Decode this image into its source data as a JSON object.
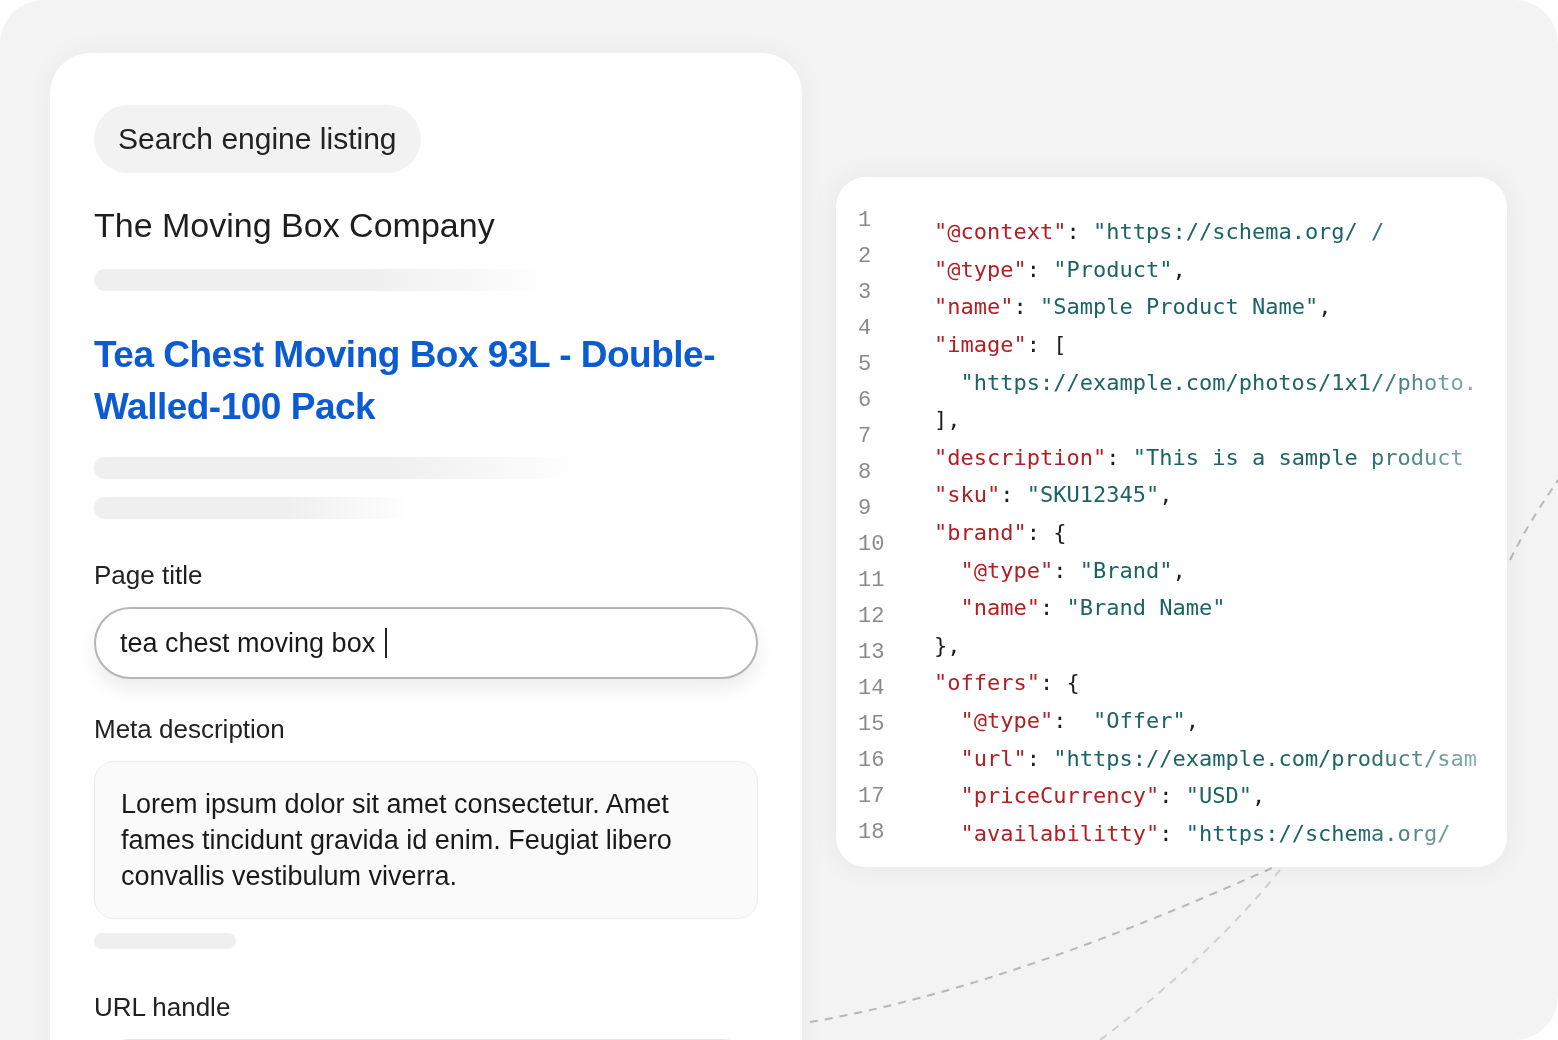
{
  "listing": {
    "badge": "Search engine listing",
    "site_name": "The Moving Box Company",
    "result_title": "Tea Chest Moving Box 93L - Double-Walled-100 Pack"
  },
  "fields": [
    {
      "label": "Page title",
      "kind": "input",
      "value": "tea chest moving box ",
      "focused": true
    },
    {
      "label": "Meta description",
      "kind": "textarea",
      "value": "Lorem ipsum dolor sit amet consectetur. Amet fames tincidunt gravida id enim. Feugiat libero convallis vestibulum viverra."
    },
    {
      "label": "URL handle",
      "kind": "input"
    }
  ],
  "line_numbers": [
    "1",
    "2",
    "3",
    "4",
    "5",
    "6",
    "7",
    "8",
    "9",
    "10",
    "11",
    "12",
    "13",
    "14",
    "15",
    "16",
    "17",
    "18"
  ],
  "code_lines": [
    {
      "tokens": [
        {
          "kind": "key",
          "text": "\"@context\""
        },
        {
          "kind": "punct",
          "text": ": "
        },
        {
          "kind": "string",
          "text": "\"https://schema.org/ /"
        }
      ]
    },
    {
      "tokens": [
        {
          "kind": "key",
          "text": "\"@type\""
        },
        {
          "kind": "punct",
          "text": ": "
        },
        {
          "kind": "string",
          "text": "\"Product\""
        },
        {
          "kind": "punct",
          "text": ","
        }
      ]
    },
    {
      "tokens": [
        {
          "kind": "key",
          "text": "\"name\""
        },
        {
          "kind": "punct",
          "text": ": "
        },
        {
          "kind": "string",
          "text": "\"Sample Product Name\""
        },
        {
          "kind": "punct",
          "text": ","
        }
      ]
    },
    {
      "tokens": [
        {
          "kind": "key",
          "text": "\"image\""
        },
        {
          "kind": "punct",
          "text": ": ["
        }
      ]
    },
    {
      "tokens": [
        {
          "kind": "string",
          "text": "  \"https://example.com/photos/1x1//photo."
        }
      ]
    },
    {
      "tokens": [
        {
          "kind": "punct",
          "text": "],"
        }
      ]
    },
    {
      "tokens": [
        {
          "kind": "key",
          "text": "\"description\""
        },
        {
          "kind": "punct",
          "text": ": "
        },
        {
          "kind": "string",
          "text": "\"This is a sample product"
        }
      ]
    },
    {
      "tokens": [
        {
          "kind": "key",
          "text": "\"sku\""
        },
        {
          "kind": "punct",
          "text": ": "
        },
        {
          "kind": "string",
          "text": "\"SKU12345\""
        },
        {
          "kind": "punct",
          "text": ","
        }
      ]
    },
    {
      "tokens": [
        {
          "kind": "key",
          "text": "\"brand\""
        },
        {
          "kind": "punct",
          "text": ": {"
        }
      ]
    },
    {
      "tokens": [
        {
          "kind": "key",
          "text": "  \"@type\""
        },
        {
          "kind": "punct",
          "text": ": "
        },
        {
          "kind": "string",
          "text": "\"Brand\""
        },
        {
          "kind": "punct",
          "text": ","
        }
      ]
    },
    {
      "tokens": [
        {
          "kind": "key",
          "text": "  \"name\""
        },
        {
          "kind": "punct",
          "text": ": "
        },
        {
          "kind": "string",
          "text": "\"Brand Name\""
        }
      ]
    },
    {
      "tokens": [
        {
          "kind": "punct",
          "text": "},"
        }
      ]
    },
    {
      "tokens": [
        {
          "kind": "key",
          "text": "\"offers\""
        },
        {
          "kind": "punct",
          "text": ": {"
        }
      ]
    },
    {
      "tokens": [
        {
          "kind": "key",
          "text": "  \"@type\""
        },
        {
          "kind": "punct",
          "text": ":  "
        },
        {
          "kind": "string",
          "text": "\"Offer\""
        },
        {
          "kind": "punct",
          "text": ","
        }
      ]
    },
    {
      "tokens": [
        {
          "kind": "key",
          "text": "  \"url\""
        },
        {
          "kind": "punct",
          "text": ": "
        },
        {
          "kind": "string",
          "text": "\"https://example.com/product/sam"
        }
      ]
    },
    {
      "tokens": [
        {
          "kind": "key",
          "text": "  \"priceCurrency\""
        },
        {
          "kind": "punct",
          "text": ": "
        },
        {
          "kind": "string",
          "text": "\"USD\""
        },
        {
          "kind": "punct",
          "text": ","
        }
      ]
    },
    {
      "tokens": [
        {
          "kind": "key",
          "text": "  \"availabilitty\""
        },
        {
          "kind": "punct",
          "text": ": "
        },
        {
          "kind": "string",
          "text": "\"https://schema.org/"
        }
      ]
    }
  ]
}
